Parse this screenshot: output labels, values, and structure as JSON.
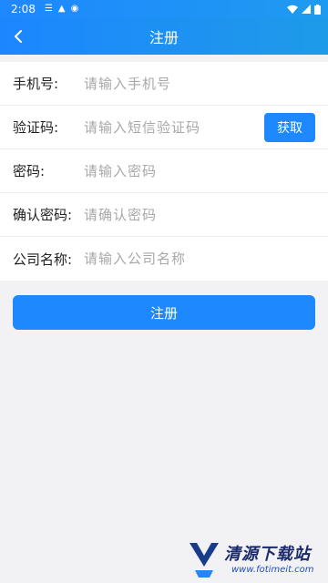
{
  "status_bar": {
    "time": "2:08"
  },
  "header": {
    "title": "注册"
  },
  "form": {
    "rows": [
      {
        "label": "手机号:",
        "placeholder": "请输入手机号"
      },
      {
        "label": "验证码:",
        "placeholder": "请输入短信验证码",
        "button": "获取"
      },
      {
        "label": "密码:",
        "placeholder": "请输入密码"
      },
      {
        "label": "确认密码:",
        "placeholder": "请确认密码"
      },
      {
        "label": "公司名称:",
        "placeholder": "请输入公司名称"
      }
    ]
  },
  "submit_label": "注册",
  "watermark": {
    "brand": "清源下载站",
    "url": "www.fotimeit.com"
  }
}
